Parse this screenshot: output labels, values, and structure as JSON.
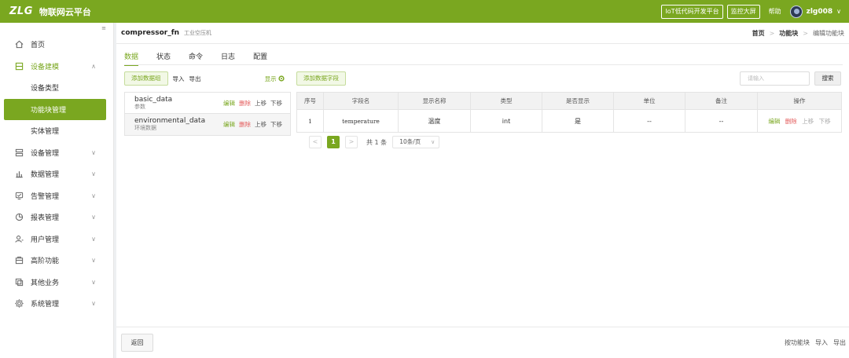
{
  "topbar": {
    "logo_mark": "ZLG",
    "app_name": "物联网云平台",
    "btn_lowcode": "IoT低代码开发平台",
    "btn_monitor": "监控大屏",
    "help": "帮助",
    "username": "zlg008",
    "chevron": "∨",
    "bg_color": "#7aa720"
  },
  "sidebar": {
    "collapse_icon": "≡",
    "items": [
      {
        "label": "首页",
        "icon": "home-icon"
      },
      {
        "label": "设备建模",
        "icon": "model-icon",
        "arrow": "∧"
      },
      {
        "label": "设备管理",
        "icon": "device-icon",
        "arrow": "∨"
      },
      {
        "label": "数据管理",
        "icon": "data-icon",
        "arrow": "∨"
      },
      {
        "label": "告警管理",
        "icon": "alarm-icon",
        "arrow": "∨"
      },
      {
        "label": "报表管理",
        "icon": "report-icon",
        "arrow": "∨"
      },
      {
        "label": "用户管理",
        "icon": "user-icon",
        "arrow": "∨"
      },
      {
        "label": "高阶功能",
        "icon": "advanced-icon",
        "arrow": "∨"
      },
      {
        "label": "其他业务",
        "icon": "other-icon",
        "arrow": "∨"
      },
      {
        "label": "系统管理",
        "icon": "settings-icon",
        "arrow": "∨"
      }
    ],
    "sub_items": [
      {
        "label": "设备类型"
      },
      {
        "label": "功能块管理"
      },
      {
        "label": "实体管理"
      }
    ]
  },
  "header": {
    "title": "compressor_fn",
    "subtitle": "工业空压机",
    "breadcrumb": [
      "首页",
      "功能块",
      "编辑功能块"
    ],
    "separator": ">"
  },
  "tabs": [
    "数据",
    "状态",
    "命令",
    "日志",
    "配置"
  ],
  "left_panel": {
    "add_group": "添加数据组",
    "import": "导入",
    "export": "导出",
    "show": "显示",
    "groups": [
      {
        "name": "basic_data",
        "desc": "参数",
        "edit": "编辑",
        "delete": "删除",
        "up": "上移",
        "down": "下移"
      },
      {
        "name": "environmental_data",
        "desc": "环境数据",
        "edit": "编辑",
        "delete": "删除",
        "up": "上移",
        "down": "下移"
      }
    ]
  },
  "right_panel": {
    "add_field": "添加数据字段",
    "search_placeholder": "请输入",
    "search_button": "搜索",
    "columns": [
      "序号",
      "字段名",
      "显示名称",
      "类型",
      "是否显示",
      "单位",
      "备注",
      "操作"
    ],
    "rows": [
      {
        "index": "1",
        "field": "temperature",
        "display": "温度",
        "type": "int",
        "visible": "是",
        "unit": "--",
        "remark": "--",
        "edit": "编辑",
        "delete": "删除",
        "up": "上移",
        "down": "下移"
      }
    ],
    "pager": {
      "prev": "<",
      "current": "1",
      "next": ">",
      "total": "共 1 条",
      "page_size": "10条/页"
    }
  },
  "footer": {
    "back": "返回",
    "by_block": "按功能块",
    "import": "导入",
    "export": "导出"
  }
}
